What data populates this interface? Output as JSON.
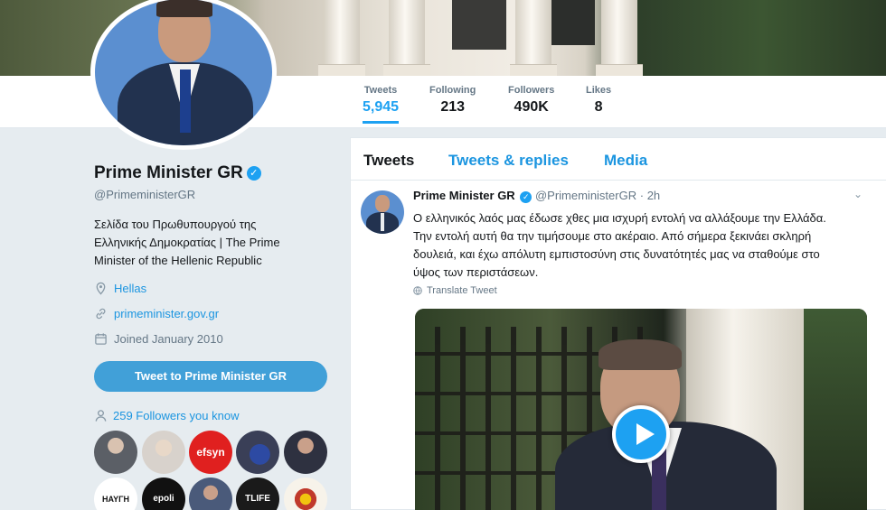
{
  "stats": [
    {
      "label": "Tweets",
      "value": "5,945"
    },
    {
      "label": "Following",
      "value": "213"
    },
    {
      "label": "Followers",
      "value": "490K"
    },
    {
      "label": "Likes",
      "value": "8"
    }
  ],
  "profile": {
    "name": "Prime Minister GR",
    "handle": "@PrimeministerGR",
    "bio_lines": [
      "Σελίδα του Πρωθυπουργού της",
      "Ελληνικής Δημοκρατίας | The Prime",
      "Minister of the Hellenic Republic"
    ],
    "location": "Hellas",
    "website": "primeminister.gov.gr",
    "joined": "Joined January 2010",
    "tweet_to_button": "Tweet to Prime Minister GR",
    "followers_you_know": "259 Followers you know",
    "follower_avatars": [
      "",
      "",
      "efsyn",
      "",
      "",
      "ΗΑΥΓΗ",
      "epoli",
      "",
      "TLIFE",
      ""
    ]
  },
  "tabs": [
    "Tweets",
    "Tweets & replies",
    "Media"
  ],
  "tweet": {
    "author": "Prime Minister GR",
    "handle": "@PrimeministerGR",
    "separator": "·",
    "time": "2h",
    "text_lines": [
      "Ο ελληνικός λαός μας έδωσε χθες μια ισχυρή εντολή να αλλάξουμε την Ελλάδα.",
      "Την εντολή αυτή θα την τιμήσουμε στο ακέραιο. Από σήμερα ξεκινάει σκληρή",
      "δουλειά, και έχω απόλυτη εμπιστοσύνη στις δυνατότητές μας να σταθούμε στο",
      "ύψος των περιστάσεων."
    ],
    "translate_label": "Translate Tweet"
  },
  "colors": {
    "accent": "#1da1f2",
    "link": "#1b95e0",
    "button": "#41a0d8"
  },
  "icons": {
    "verified": "verified-badge-icon",
    "location": "location-pin-icon",
    "link": "link-icon",
    "calendar": "calendar-icon",
    "followers": "person-icon",
    "globe": "globe-icon",
    "caret": "chevron-down-icon",
    "play": "play-icon"
  }
}
